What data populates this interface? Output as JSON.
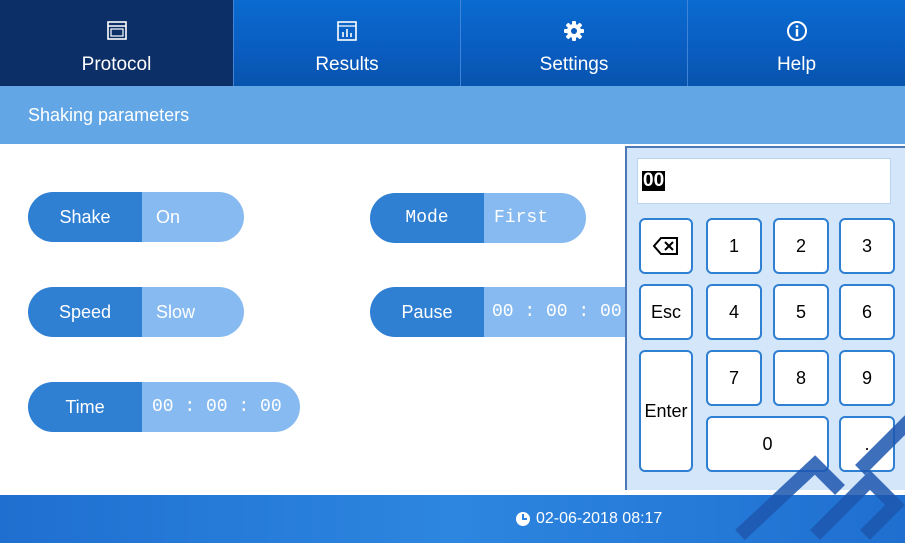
{
  "nav": {
    "tabs": [
      {
        "label": "Protocol",
        "icon": "monitor-icon",
        "active": true
      },
      {
        "label": "Results",
        "icon": "bar-chart-icon",
        "active": false
      },
      {
        "label": "Settings",
        "icon": "gear-icon",
        "active": false
      },
      {
        "label": "Help",
        "icon": "info-icon",
        "active": false
      }
    ]
  },
  "subheader": {
    "title": "Shaking parameters"
  },
  "params": {
    "shake": {
      "key": "Shake",
      "value": "On"
    },
    "speed": {
      "key": "Speed",
      "value": "Slow"
    },
    "time": {
      "key": "Time",
      "value": "00 : 00 : 00"
    },
    "mode": {
      "key": "Mode",
      "value": "First"
    },
    "pause": {
      "key": "Pause",
      "value": "00 : 00 : 00"
    }
  },
  "keypad": {
    "display": "00",
    "keys": {
      "backspace": "⌫",
      "esc": "Esc",
      "enter": "Enter",
      "k1": "1",
      "k2": "2",
      "k3": "3",
      "k4": "4",
      "k5": "5",
      "k6": "6",
      "k7": "7",
      "k8": "8",
      "k9": "9",
      "k0": "0",
      "dot": "."
    }
  },
  "footer": {
    "datetime": "02-06-2018 08:17"
  },
  "colors": {
    "nav": "#0a5cc0",
    "active_tab": "#0b2f66",
    "subheader": "#62a6e6",
    "pill_key": "#2f7fd3",
    "pill_val": "#87baf0"
  }
}
